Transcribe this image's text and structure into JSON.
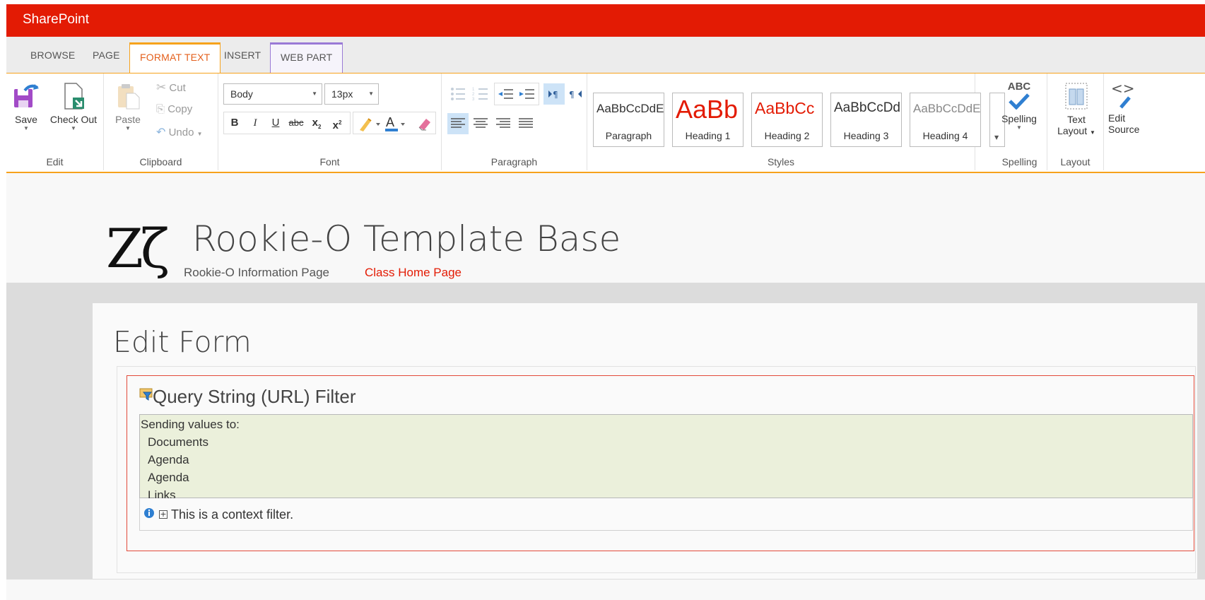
{
  "suite_bar": {
    "brand": "SharePoint",
    "color": "#e31b04"
  },
  "tabs": [
    {
      "label": "BROWSE"
    },
    {
      "label": "PAGE"
    },
    {
      "label": "FORMAT TEXT",
      "selected": true
    },
    {
      "label": "INSERT"
    },
    {
      "label": "WEB PART",
      "contextual": true
    }
  ],
  "ribbon": {
    "edit": {
      "group_label": "Edit",
      "save": "Save",
      "check_out": "Check Out"
    },
    "clipboard": {
      "group_label": "Clipboard",
      "paste": "Paste",
      "cut": "Cut",
      "copy": "Copy",
      "undo": "Undo"
    },
    "font": {
      "group_label": "Font",
      "font_name": "Body",
      "font_size": "13px",
      "bold": "B",
      "italic": "I",
      "underline": "U",
      "strike": "abc",
      "subscript": "x",
      "superscript": "x"
    },
    "paragraph": {
      "group_label": "Paragraph"
    },
    "styles": {
      "group_label": "Styles",
      "items": [
        {
          "preview": "AaBbCcDdE",
          "name": "Paragraph",
          "color": "#333333"
        },
        {
          "preview": "AaBb",
          "name": "Heading 1",
          "color": "#e31b04"
        },
        {
          "preview": "AaBbCc",
          "name": "Heading 2",
          "color": "#e31b04"
        },
        {
          "preview": "AaBbCcDd",
          "name": "Heading 3",
          "color": "#333333"
        },
        {
          "preview": "AaBbCcDdE",
          "name": "Heading 4",
          "color": "#888888"
        }
      ]
    },
    "spelling": {
      "group_label": "Spelling",
      "icon_text": "ABC",
      "label": "Spelling"
    },
    "layout": {
      "group_label": "Layout",
      "label_line1": "Text",
      "label_line2": "Layout"
    },
    "markup": {
      "label_line1": "Edit",
      "label_line2": "Source"
    }
  },
  "site": {
    "logo_text": "Zζ",
    "title": "Rookie-O Template Base",
    "nav": [
      "Rookie-O Information Page",
      "Class Home Page"
    ]
  },
  "page": {
    "title": "Edit Form",
    "webpart": {
      "title": "Query String (URL) Filter",
      "sending_header": "Sending values to:",
      "targets": [
        "Documents",
        "Agenda",
        "Agenda",
        "Links"
      ],
      "context_note": "This is a context filter."
    }
  }
}
